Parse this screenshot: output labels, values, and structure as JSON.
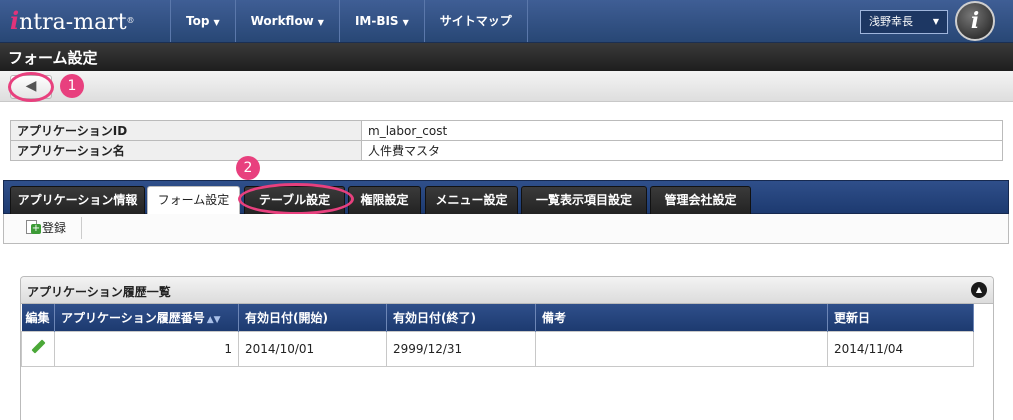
{
  "header": {
    "logo_mark": "i",
    "logo_text": "ntra-mart",
    "logo_reg": "®",
    "nav": [
      {
        "label": "Top",
        "caret": "▼"
      },
      {
        "label": "Workflow",
        "caret": "▼"
      },
      {
        "label": "IM-BIS",
        "caret": "▼"
      },
      {
        "label": "サイトマップ",
        "caret": ""
      }
    ],
    "user_name": "浅野幸長",
    "user_caret": "▼",
    "avatar_glyph": "i"
  },
  "page": {
    "title": "フォーム設定"
  },
  "toolbar": {
    "back_glyph": "◀"
  },
  "callouts": [
    "1",
    "2"
  ],
  "info": {
    "rows": [
      {
        "label": "アプリケーションID",
        "value": "m_labor_cost"
      },
      {
        "label": "アプリケーション名",
        "value": "人件費マスタ"
      }
    ]
  },
  "tabs": [
    {
      "label": "アプリケーション情報",
      "active": false
    },
    {
      "label": "フォーム設定",
      "active": true
    },
    {
      "label": "テーブル設定",
      "active": false
    },
    {
      "label": "権限設定",
      "active": false
    },
    {
      "label": "メニュー設定",
      "active": false
    },
    {
      "label": "一覧表示項目設定",
      "active": false
    },
    {
      "label": "管理会社設定",
      "active": false
    }
  ],
  "actions": {
    "register_label": "登録"
  },
  "history": {
    "title": "アプリケーション履歴一覧",
    "collapse_glyph": "▲",
    "columns": [
      "編集",
      "アプリケーション履歴番号",
      "有効日付(開始)",
      "有効日付(終了)",
      "備考",
      "更新日"
    ],
    "sort_glyph": "▲▼",
    "rows": [
      {
        "edit": "",
        "number": "1",
        "start": "2014/10/01",
        "end": "2999/12/31",
        "note": "",
        "updated": "2014/11/04"
      }
    ]
  },
  "colors": {
    "header_blue": "#2f4f8a",
    "callout_pink": "#e8407e",
    "title_bar": "#2a2a2a"
  }
}
